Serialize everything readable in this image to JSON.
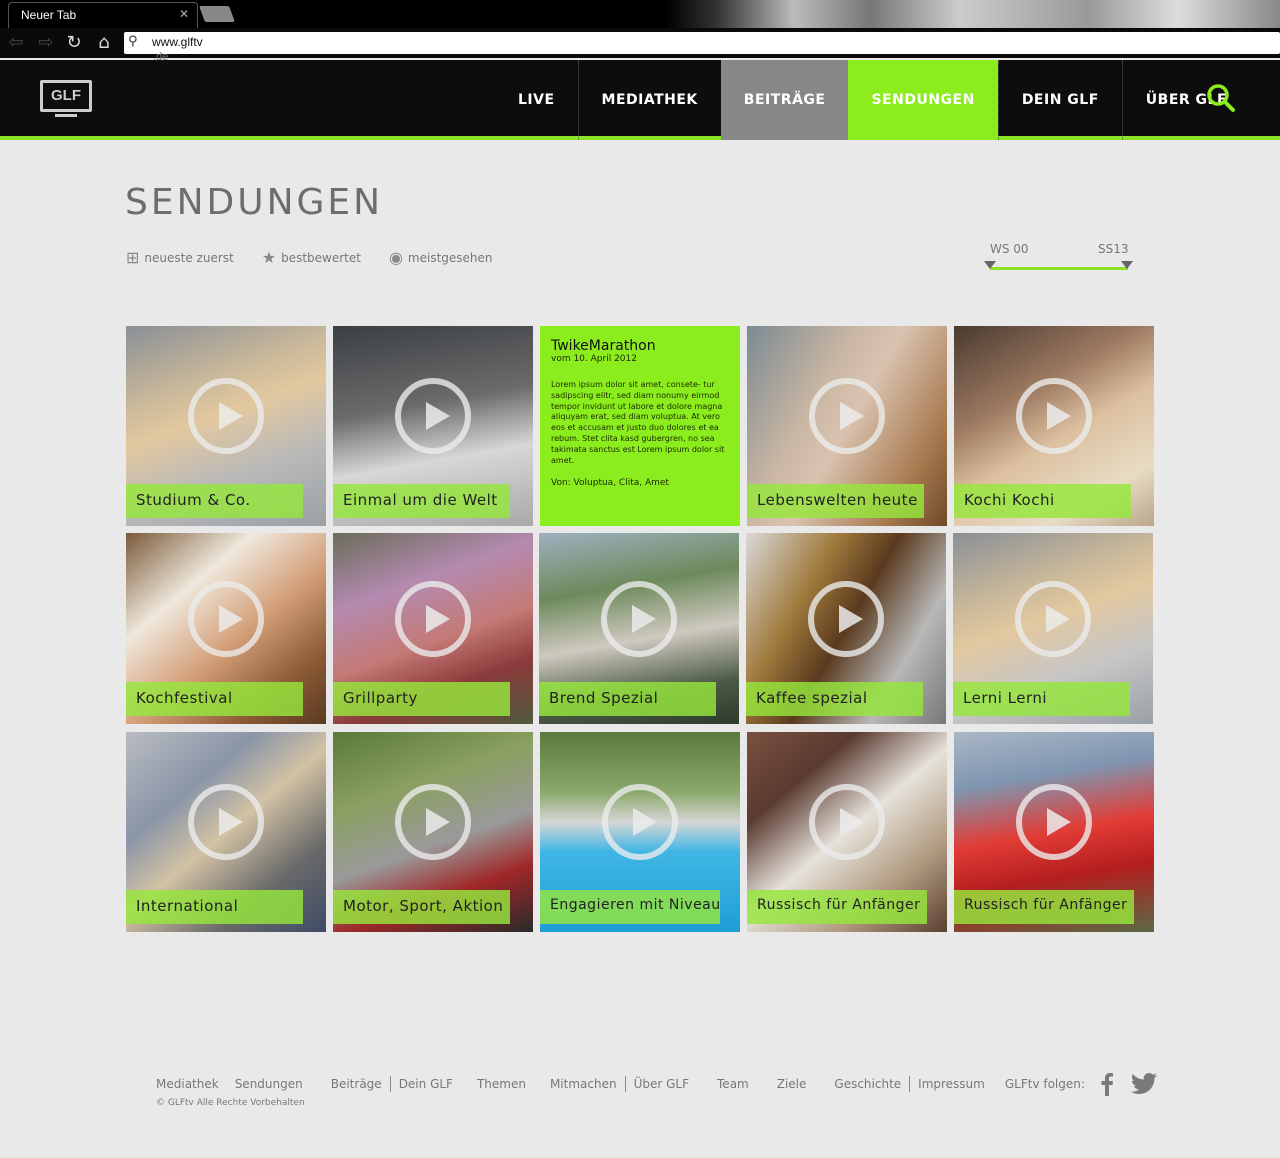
{
  "browser": {
    "tab_title": "Neuer Tab",
    "url": "www.glftv",
    "url_wrap": ".de"
  },
  "site": {
    "logo_text": "GLF",
    "nav": [
      "LIVE",
      "MEDIATHEK",
      "BEITRÄGE",
      "SENDUNGEN",
      "DEIN GLF",
      "ÜBER GLF"
    ],
    "accent": "#8ced1e"
  },
  "page": {
    "title": "SENDUNGEN",
    "sorts": [
      "neueste zuerst",
      "bestbewertet",
      "meistgesehen"
    ],
    "range": {
      "start": "WS 00",
      "end": "SS13"
    }
  },
  "tiles": [
    "Studium & Co.",
    "Einmal um die Welt",
    "Lebenswelten heute",
    "Kochi Kochi",
    "Kochfestival",
    "Grillparty",
    "Brend Spezial",
    "Kaffee spezial",
    "Lerni Lerni",
    "International",
    "Motor, Sport, Aktion",
    "Engagieren mit Niveau",
    "Russisch für Anfänger",
    "Russisch für Anfänger"
  ],
  "info_tile": {
    "title": "TwikeMarathon",
    "date": "vom 10. April 2012",
    "body": "Lorem ipsum dolor sit amet, consete- tur sadipscing elitr, sed diam nonumy eirmod tempor invidunt ut labore et dolore magna aliquyam erat, sed diam voluptua. At vero eos et accusam et justo duo dolores et ea rebum. Stet clita kasd gubergren, no sea takimata sanctus est Lorem ipsum dolor sit amet.",
    "by": "Von: Voluptua, Clita, Amet"
  },
  "footer": {
    "links": [
      "Mediathek",
      "Sendungen",
      "Beiträge",
      "Dein GLF",
      "Themen",
      "Mitmachen",
      "Über GLF",
      "Team",
      "Ziele",
      "Geschichte",
      "Impressum"
    ],
    "follow": "GLFtv folgen:",
    "copyright": "© GLFtv Alle Rechte Vorbehalten"
  }
}
